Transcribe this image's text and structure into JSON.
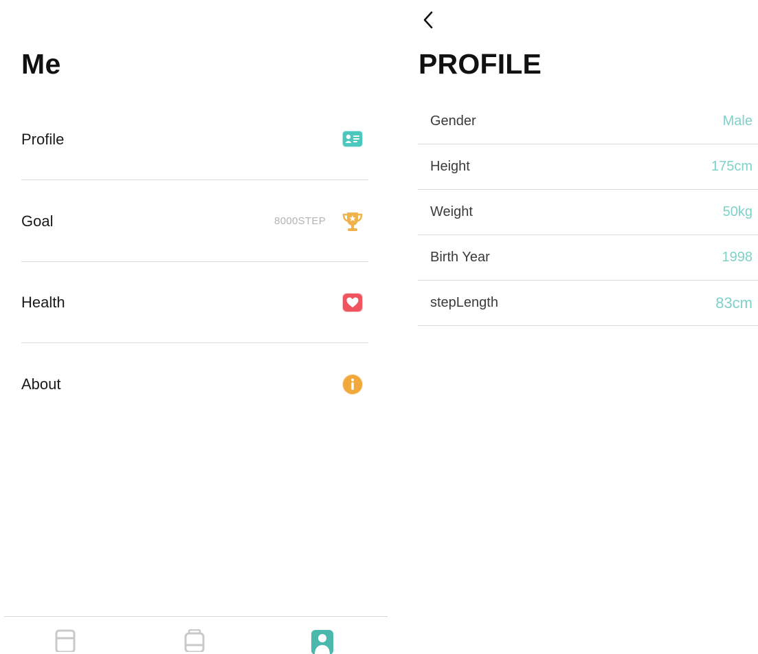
{
  "colors": {
    "accent": "#7fd1c9",
    "profile_icon": "#4cc7bd",
    "goal_icon": "#f0b24a",
    "health_icon": "#f0555f",
    "about_icon": "#f2a93b",
    "tab_inactive": "#c9c9c9",
    "tab_active": "#4bb8ad"
  },
  "me": {
    "title": "Me",
    "menu": [
      {
        "label": "Profile",
        "value": "",
        "icon": "id-card-icon"
      },
      {
        "label": "Goal",
        "value": "8000STEP",
        "icon": "trophy-icon"
      },
      {
        "label": "Health",
        "value": "",
        "icon": "heart-icon"
      },
      {
        "label": "About",
        "value": "",
        "icon": "info-icon"
      }
    ]
  },
  "tabbar": {
    "tabs": [
      {
        "icon": "record-icon",
        "active": false
      },
      {
        "icon": "device-icon",
        "active": false
      },
      {
        "icon": "user-icon",
        "active": true
      }
    ]
  },
  "profile": {
    "back_icon": "chevron-left-icon",
    "title": "PROFILE",
    "rows": [
      {
        "label": "Gender",
        "value": "Male"
      },
      {
        "label": "Height",
        "value": "175cm"
      },
      {
        "label": "Weight",
        "value": "50kg"
      },
      {
        "label": "Birth Year",
        "value": "1998"
      },
      {
        "label": "stepLength",
        "value": "83cm"
      }
    ]
  }
}
